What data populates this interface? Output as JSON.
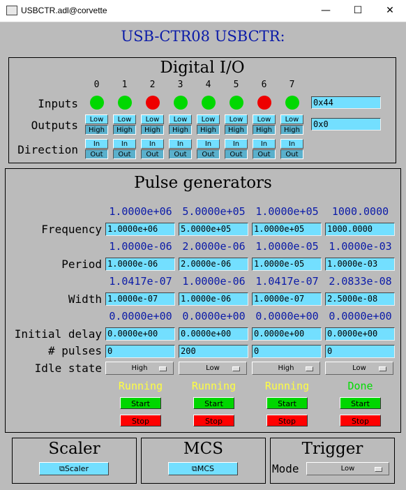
{
  "window": {
    "title": "USBCTR.adl@corvette",
    "minimize": "—",
    "maximize": "☐",
    "close": "✕"
  },
  "header": {
    "title": "USB-CTR08  USBCTR:"
  },
  "digital_io": {
    "heading": "Digital I/O",
    "bit_labels": [
      "0",
      "1",
      "2",
      "3",
      "4",
      "5",
      "6",
      "7"
    ],
    "inputs_label": "Inputs",
    "outputs_label": "Outputs",
    "direction_label": "Direction",
    "input_states": [
      "green",
      "green",
      "red",
      "green",
      "green",
      "green",
      "red",
      "green"
    ],
    "inputs_value": "0x44",
    "outputs_value": "0x0",
    "low_label": "Low",
    "high_label": "High",
    "in_label": "In",
    "out_label": "Out",
    "colors": {
      "on": "#00d800",
      "off": "#ee0000"
    }
  },
  "pulse": {
    "heading": "Pulse generators",
    "labels": {
      "frequency": "Frequency",
      "period": "Period",
      "width": "Width",
      "initial_delay": "Initial delay",
      "pulses": "# pulses",
      "idle_state": "Idle state"
    },
    "channels": [
      {
        "freq_rb": "1.0000e+06",
        "freq": "1.0000e+06",
        "period_rb": "1.0000e-06",
        "period": "1.0000e-06",
        "width_rb": "1.0417e-07",
        "width": "1.0000e-07",
        "delay_rb": "0.0000e+00",
        "delay": "0.0000e+00",
        "pulses": "0",
        "idle": "High",
        "status": "Running",
        "start": "Start",
        "stop": "Stop"
      },
      {
        "freq_rb": "5.0000e+05",
        "freq": "5.0000e+05",
        "period_rb": "2.0000e-06",
        "period": "2.0000e-06",
        "width_rb": "1.0000e-06",
        "width": "1.0000e-06",
        "delay_rb": "0.0000e+00",
        "delay": "0.0000e+00",
        "pulses": "200",
        "idle": "Low",
        "status": "Running",
        "start": "Start",
        "stop": "Stop"
      },
      {
        "freq_rb": "1.0000e+05",
        "freq": "1.0000e+05",
        "period_rb": "1.0000e-05",
        "period": "1.0000e-05",
        "width_rb": "1.0417e-07",
        "width": "1.0000e-07",
        "delay_rb": "0.0000e+00",
        "delay": "0.0000e+00",
        "pulses": "0",
        "idle": "High",
        "status": "Running",
        "start": "Start",
        "stop": "Stop"
      },
      {
        "freq_rb": "1000.0000",
        "freq": "1000.0000",
        "period_rb": "1.0000e-03",
        "period": "1.0000e-03",
        "width_rb": "2.0833e-08",
        "width": "2.5000e-08",
        "delay_rb": "0.0000e+00",
        "delay": "0.0000e+00",
        "pulses": "0",
        "idle": "Low",
        "status": "Done",
        "start": "Start",
        "stop": "Stop"
      }
    ],
    "status_colors": {
      "Running": "#ffff40",
      "Done": "#00dd00"
    }
  },
  "scaler": {
    "heading": "Scaler",
    "button": "⧉Scaler"
  },
  "mcs": {
    "heading": "MCS",
    "button": "⧉MCS"
  },
  "trigger": {
    "heading": "Trigger",
    "mode_label": "Mode",
    "mode_value": "Low"
  }
}
